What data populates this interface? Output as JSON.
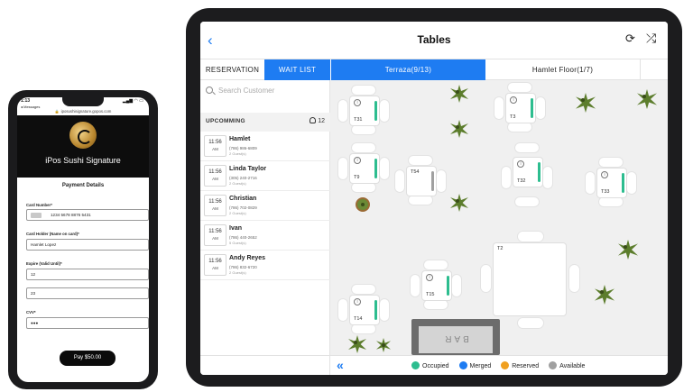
{
  "phone": {
    "status_time": "1:13",
    "back_label": "◂ Messages",
    "status_icons": "▂▄▆ ◠ ▭",
    "url": "iposushisignature.gopos.com",
    "brand": "iPos Sushi Signature",
    "section_title": "Payment Details",
    "card_number_label": "Card Number*",
    "card_number_value": "1234 5678 8876 5431",
    "card_holder_label": "Card Holder (Name on card)*",
    "card_holder_value": "Hamlet Lopez",
    "expire_label": "Expire (Valid Until)*",
    "expire_month": "12",
    "expire_year": "23",
    "cvv_label": "CVV*",
    "cvv_value": "●●●",
    "pay_button": "Pay $50.00"
  },
  "ipad": {
    "title": "Tables",
    "back_icon": "‹",
    "refresh_icon": "⟳",
    "shuffle_icon": "⤮",
    "tabs": {
      "reservation": "RESERVATION",
      "wait_list": "WAIT LIST",
      "terraza": "Terraza(9/13)",
      "hamlet_floor": "Hamlet Floor(1/7)"
    },
    "search_placeholder": "Search Customer",
    "upcoming_label": "UPCOMMING",
    "upcoming_count": "12",
    "guests": [
      {
        "time": "11:56",
        "ampm": "AM",
        "name": "Hamlet",
        "phone": "(786) 986-6809",
        "guests": "2 Guest(s)"
      },
      {
        "time": "11:56",
        "ampm": "AM",
        "name": "Linda  Taylor",
        "phone": "(305) 240-2716",
        "guests": "2 Guest(s)"
      },
      {
        "time": "11:56",
        "ampm": "AM",
        "name": "Christian",
        "phone": "(786) 702-0829",
        "guests": "2 Guest(s)"
      },
      {
        "time": "11:56",
        "ampm": "AM",
        "name": "Ivan",
        "phone": "(786) 440-2652",
        "guests": "5 Guest(s)"
      },
      {
        "time": "11:56",
        "ampm": "AM",
        "name": "Andy Reyes",
        "phone": "(786) 832-6720",
        "guests": "2 Guest(s)"
      }
    ],
    "tables": {
      "t31": "T31",
      "t3": "T3",
      "t9": "T9",
      "t54": "T54",
      "t32": "T32",
      "t33": "T33",
      "t2": "T2",
      "t15": "T15",
      "t14": "T14"
    },
    "bar_label": "BAR",
    "collapse_icon": "«",
    "legend": {
      "occupied": "Occupied",
      "merged": "Merged",
      "reserved": "Reserved",
      "available": "Available"
    },
    "colors": {
      "accent": "#1e7cf2",
      "occupied": "#2dbd8f",
      "merged": "#1e7cf2",
      "reserved": "#f0a020",
      "available": "#a0a0a0"
    }
  }
}
